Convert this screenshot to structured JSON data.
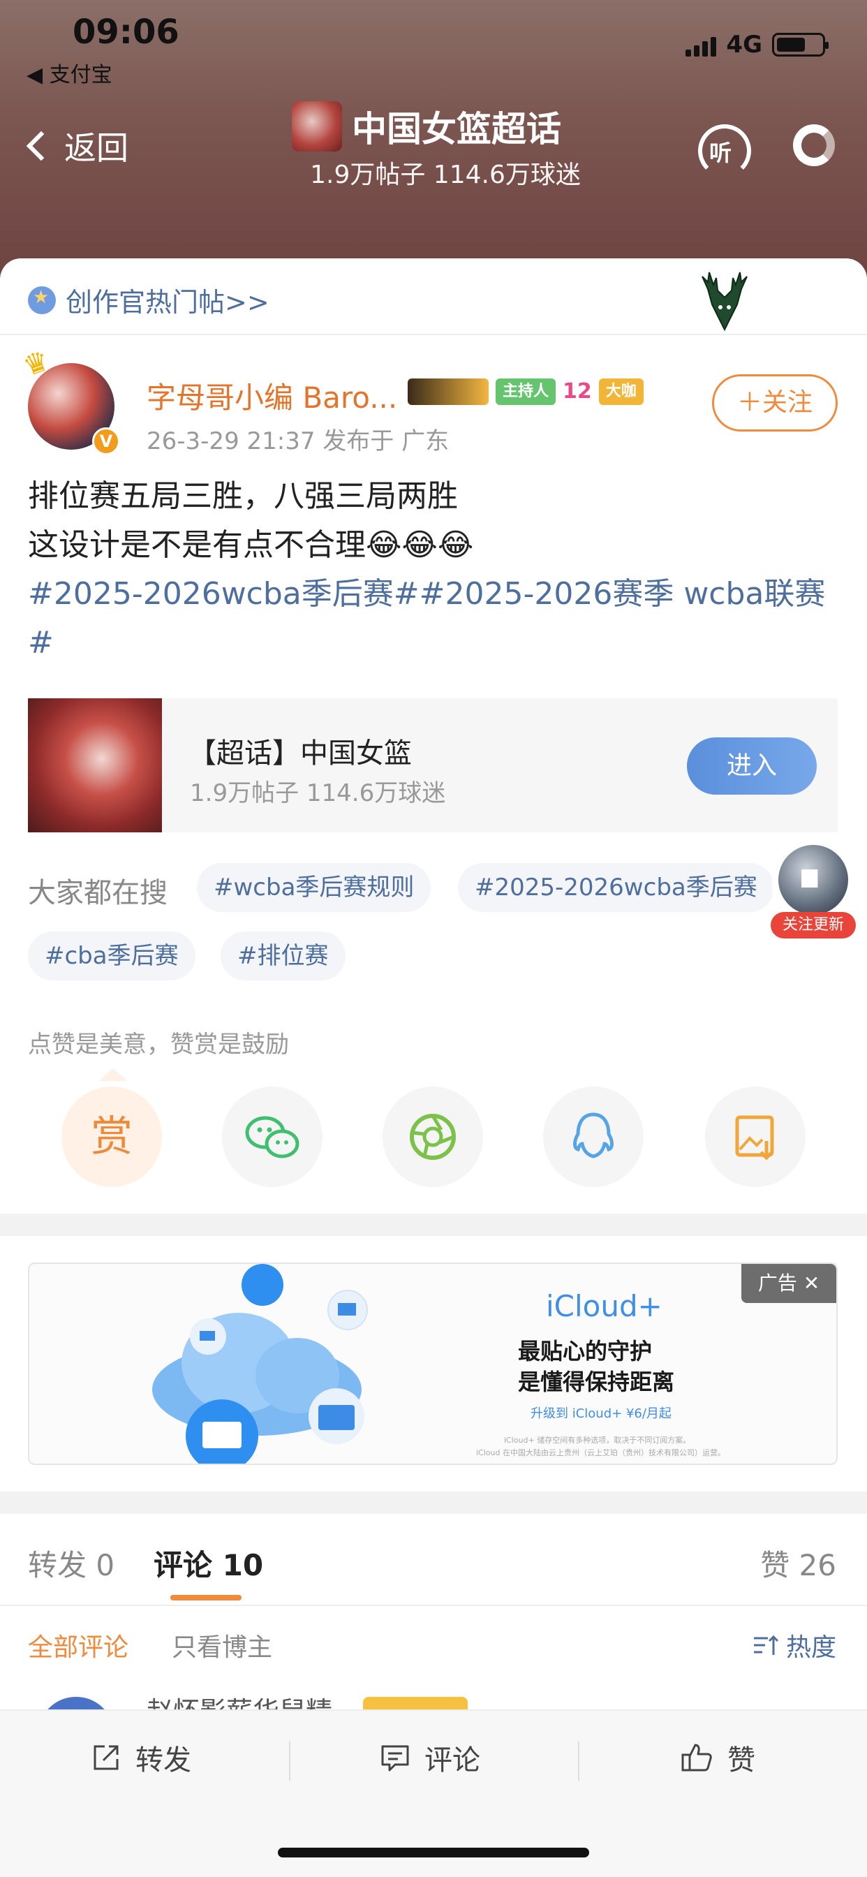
{
  "status": {
    "time": "09:06",
    "back_app": "◀ 支付宝",
    "network": "4G"
  },
  "header": {
    "back_label": "返回",
    "title": "中国女篮超话",
    "subtitle": "1.9万帖子 114.6万球迷",
    "listen_label": "听"
  },
  "hot_link": "创作官热门帖>>",
  "post": {
    "username": "字母哥小编 Baro...",
    "verified_mark": "V",
    "badges": {
      "host": "主持人",
      "level_num": "12",
      "bigshot": "大咖"
    },
    "meta": "26-3-29 21:37  发布于 广东",
    "follow_label": "＋关注",
    "text_line1": "排位赛五局三胜，八强三局两胜",
    "text_line2": "这设计是不是有点不合理😂😂😂",
    "tags": "#2025-2026wcba季后赛##2025-2026赛季 wcba联赛#"
  },
  "topic_card": {
    "title": "【超话】中国女篮",
    "subtitle": "1.9万帖子 114.6万球迷",
    "enter_label": "进入"
  },
  "search": {
    "label": "大家都在搜",
    "chips": [
      "#wcba季后赛规则",
      "#2025-2026wcba季后赛",
      "#cba季后赛",
      "#排位赛"
    ]
  },
  "float_follow": {
    "label": "关注更新"
  },
  "reward": {
    "hint": "点赞是美意，赞赏是鼓励",
    "reward_label": "赏",
    "share_icons": [
      "wechat-icon",
      "moments-icon",
      "qq-icon",
      "save-image-icon"
    ]
  },
  "ad": {
    "badge": "广告 ✕",
    "title": "iCloud+",
    "line1": "最贴心的守护",
    "line2": "是懂得保持距离",
    "cta": "升级到 iCloud+ ¥6/月起",
    "fine1": "iCloud+ 储存空间有多种选项，取决于不同订阅方案。",
    "fine2": "iCloud 在中国大陆由云上贵州（云上艾珀（贵州）技术有限公司）运营。"
  },
  "tabs": {
    "repost": "转发 0",
    "comment": "评论 10",
    "like": "赞 26"
  },
  "filters": {
    "all": "全部评论",
    "op_only": "只看博主",
    "sort": "热度"
  },
  "comment_peek": {
    "name": "赵怀影薪华鼠精"
  },
  "bottom_bar": {
    "repost": "转发",
    "comment": "评论",
    "like": "赞"
  },
  "colors": {
    "accent_orange": "#f08a3c",
    "link_blue": "#4e6e9e",
    "enter_blue": "#5a8fdb"
  }
}
